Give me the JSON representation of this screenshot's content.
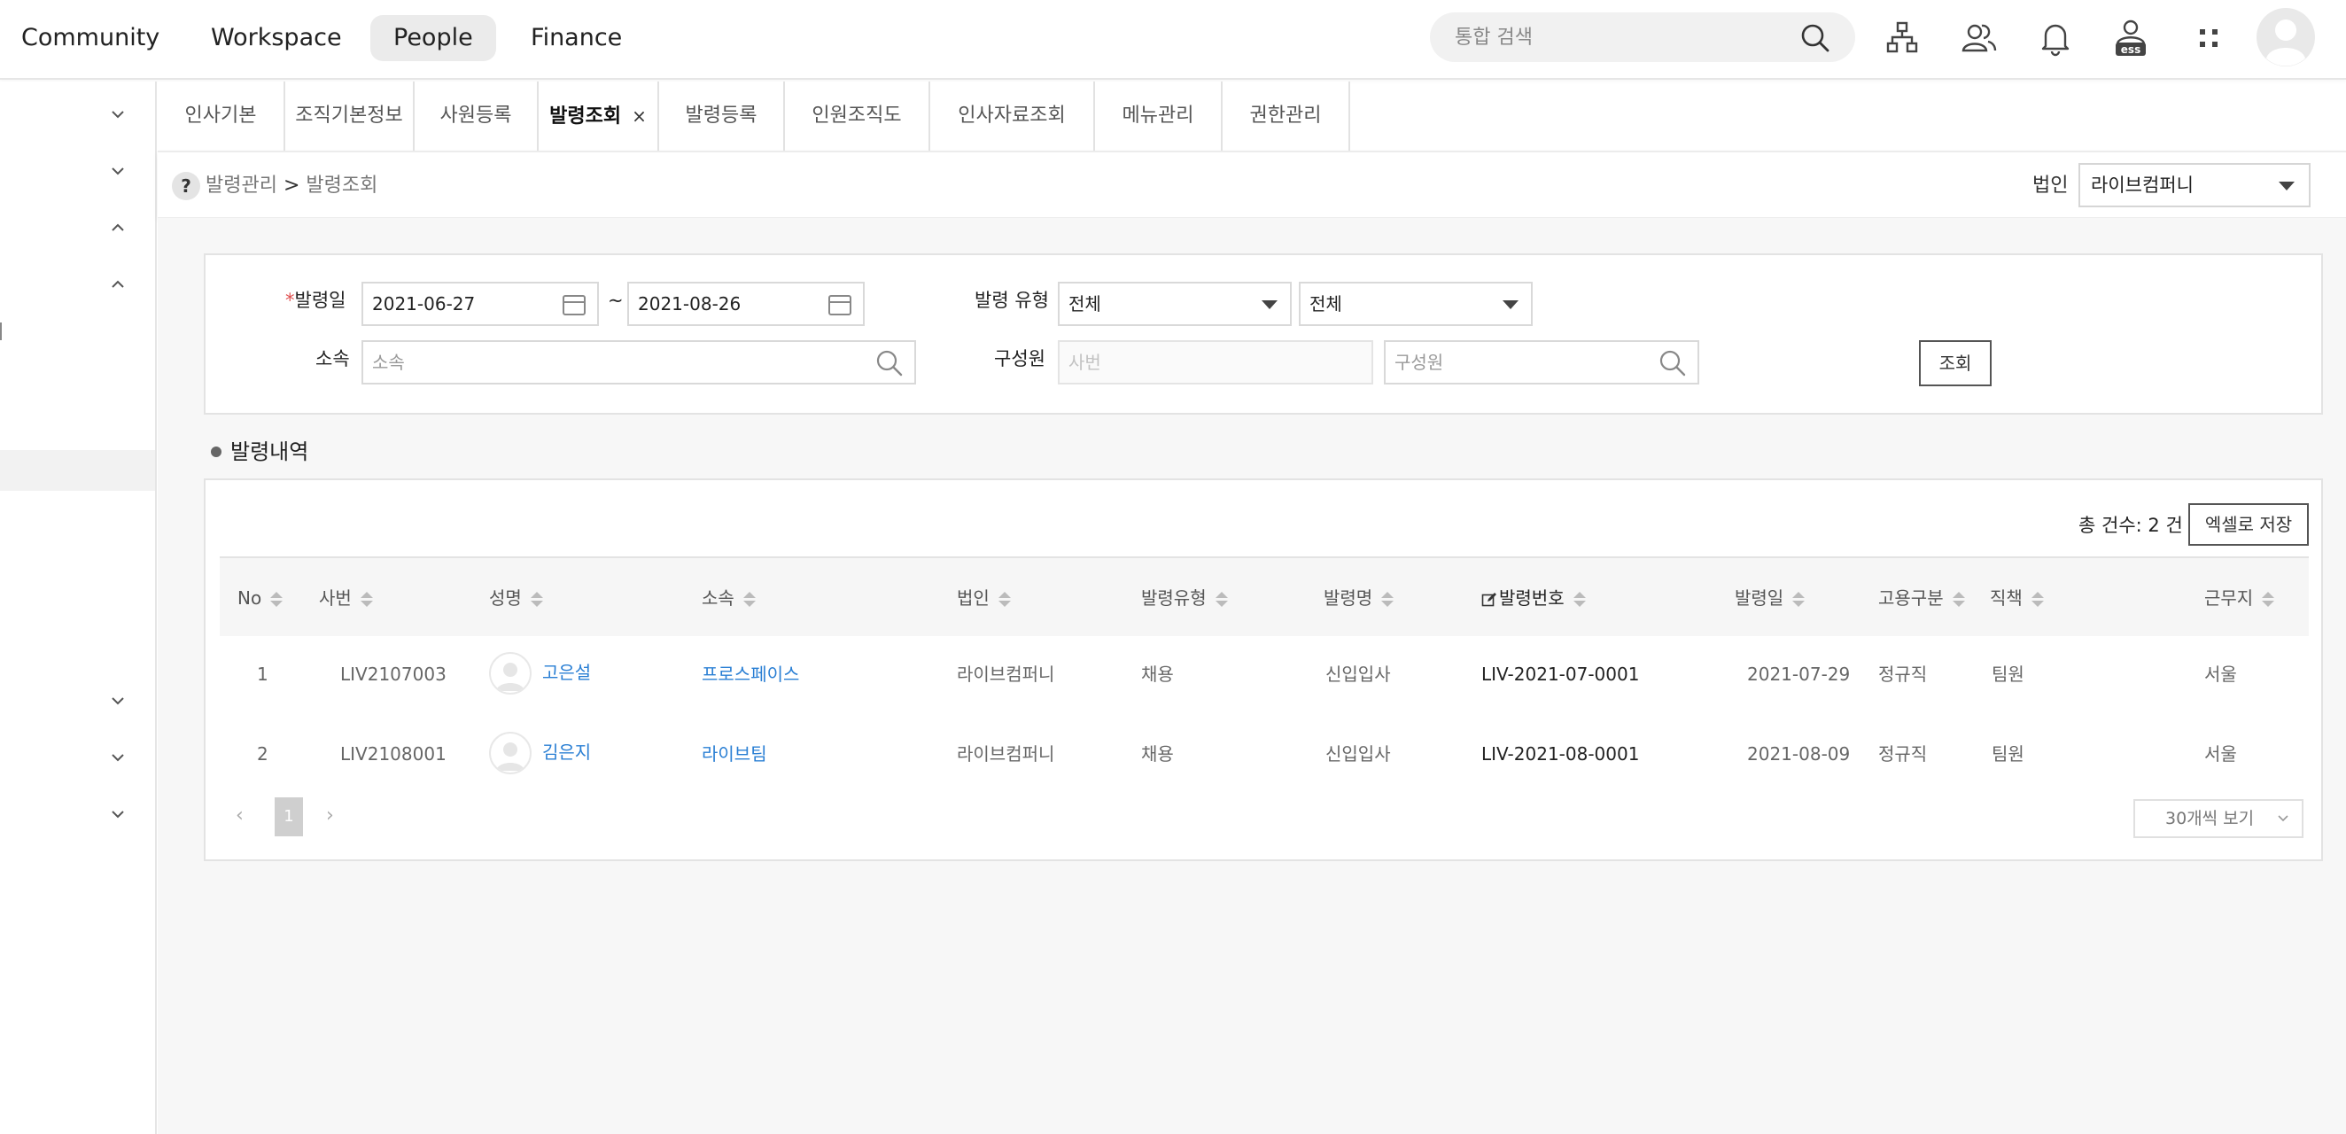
{
  "topnav": {
    "items": [
      "Community",
      "Workspace",
      "People",
      "Finance"
    ],
    "active": "People",
    "search_placeholder": "통합 검색",
    "ess_label": "ess"
  },
  "tabs": [
    {
      "label": "인사기본"
    },
    {
      "label": "조직기본정보"
    },
    {
      "label": "사원등록"
    },
    {
      "label": "발령조회",
      "active": true,
      "close": "×"
    },
    {
      "label": "발령등록"
    },
    {
      "label": "인원조직도"
    },
    {
      "label": "인사자료조회"
    },
    {
      "label": "메뉴관리"
    },
    {
      "label": "권한관리"
    }
  ],
  "breadcrumb": {
    "help": "?",
    "parent": "발령관리",
    "sep": ">",
    "current": "발령조회",
    "corp_label": "법인",
    "corp_value": "라이브컴퍼니"
  },
  "filter": {
    "date_required": "*",
    "date_label": "발령일",
    "date_from": "2021-06-27",
    "date_sep": "~",
    "date_to": "2021-08-26",
    "type_label": "발령 유형",
    "type_value_1": "전체",
    "type_value_2": "전체",
    "dept_label": "소속",
    "dept_placeholder": "소속",
    "member_label": "구성원",
    "member_id_placeholder": "사번",
    "member_name_placeholder": "구성원",
    "search_button": "조회"
  },
  "results": {
    "section_title": "발령내역",
    "total_prefix": "총 건수:",
    "total_count": "2",
    "total_unit": "건",
    "excel_button": "엑셀로 저장",
    "columns": [
      "No",
      "사번",
      "성명",
      "소속",
      "법인",
      "발령유형",
      "발령명",
      "발령번호",
      "발령일",
      "고용구분",
      "직책",
      "근무지"
    ],
    "rows": [
      {
        "no": "1",
        "emp_id": "LIV2107003",
        "name": "고은설",
        "dept": "프로스페이스",
        "corp": "라이브컴퍼니",
        "type": "채용",
        "title": "신입입사",
        "order_no": "LIV-2021-07-0001",
        "date": "2021-07-29",
        "employment": "정규직",
        "position": "팀원",
        "location": "서울"
      },
      {
        "no": "2",
        "emp_id": "LIV2108001",
        "name": "김은지",
        "dept": "라이브팀",
        "corp": "라이브컴퍼니",
        "type": "채용",
        "title": "신입입사",
        "order_no": "LIV-2021-08-0001",
        "date": "2021-08-09",
        "employment": "정규직",
        "position": "팀원",
        "location": "서울"
      }
    ],
    "pagination": {
      "prev": "‹",
      "current": "1",
      "next": "›"
    },
    "per_page": "30개씩 보기"
  },
  "colors": {
    "link": "#2a7fd4",
    "required": "#e05050",
    "active_nav_bg": "#ebebeb"
  }
}
